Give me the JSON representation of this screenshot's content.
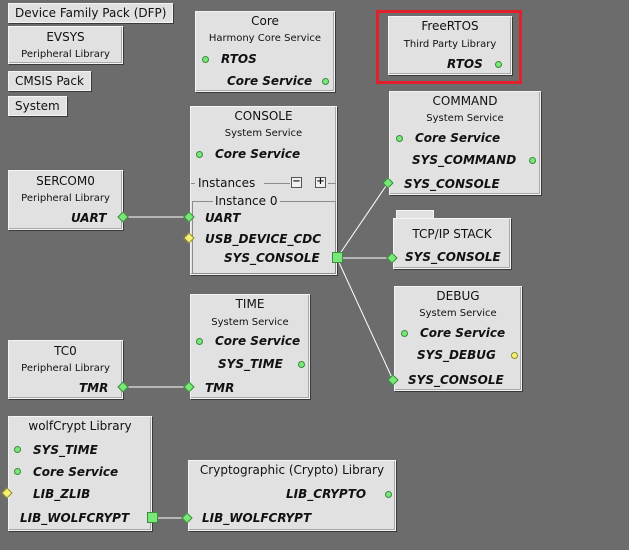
{
  "chips": {
    "dfp": "Device Family Pack (DFP)",
    "cmsis": "CMSIS Pack",
    "system": "System"
  },
  "evsys": {
    "title": "EVSYS",
    "subtitle": "Peripheral Library"
  },
  "core": {
    "title": "Core",
    "subtitle": "Harmony Core Service",
    "rtos": "RTOS",
    "core_service": "Core Service"
  },
  "freertos": {
    "title": "FreeRTOS",
    "subtitle": "Third Party Library",
    "rtos": "RTOS"
  },
  "console": {
    "title": "CONSOLE",
    "subtitle": "System Service",
    "core_service": "Core Service",
    "instances": "Instances",
    "minus": "−",
    "plus": "+",
    "instance0": "Instance 0",
    "uart": "UART",
    "usb": "USB_DEVICE_CDC",
    "sys_console": "SYS_CONSOLE"
  },
  "command": {
    "title": "COMMAND",
    "subtitle": "System Service",
    "core_service": "Core Service",
    "sys_command": "SYS_COMMAND",
    "sys_console": "SYS_CONSOLE"
  },
  "tcpip": {
    "title": "TCP/IP STACK",
    "sys_console": "SYS_CONSOLE"
  },
  "debug": {
    "title": "DEBUG",
    "subtitle": "System Service",
    "core_service": "Core Service",
    "sys_debug": "SYS_DEBUG",
    "sys_console": "SYS_CONSOLE"
  },
  "sercom0": {
    "title": "SERCOM0",
    "subtitle": "Peripheral Library",
    "uart": "UART"
  },
  "time": {
    "title": "TIME",
    "subtitle": "System Service",
    "core_service": "Core Service",
    "sys_time": "SYS_TIME",
    "tmr": "TMR"
  },
  "tc0": {
    "title": "TC0",
    "subtitle": "Peripheral Library",
    "tmr": "TMR"
  },
  "wolfcrypt": {
    "title": "wolfCrypt Library",
    "sys_time": "SYS_TIME",
    "core_service": "Core Service",
    "lib_zlib": "LIB_ZLIB",
    "lib_wolfcrypt": "LIB_WOLFCRYPT"
  },
  "crypto": {
    "title": "Cryptographic (Crypto) Library",
    "lib_crypto": "LIB_CRYPTO",
    "lib_wolfcrypt": "LIB_WOLFCRYPT"
  },
  "colors": {
    "canvas": "#6c6c6c",
    "node": "#e1e1e1",
    "connected": "#78e878",
    "optional": "#f6f07a",
    "highlight": "#e0202a",
    "wire": "#ffffff"
  }
}
